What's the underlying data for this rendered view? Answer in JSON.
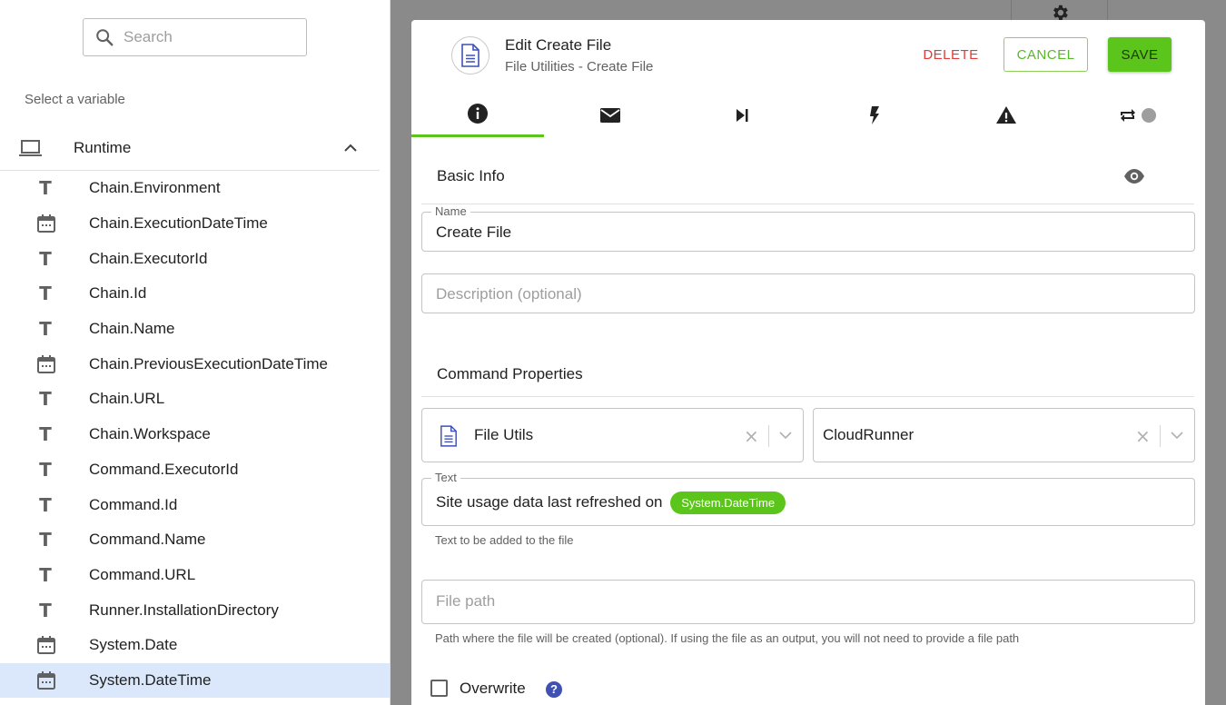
{
  "left_panel": {
    "search": {
      "placeholder": "Search",
      "value": ""
    },
    "select_label": "Select a variable",
    "group": {
      "title": "Runtime",
      "icon": "laptop-icon",
      "expanded": true
    },
    "variables": [
      {
        "name": "Chain.Environment",
        "type": "text"
      },
      {
        "name": "Chain.ExecutionDateTime",
        "type": "date"
      },
      {
        "name": "Chain.ExecutorId",
        "type": "text"
      },
      {
        "name": "Chain.Id",
        "type": "text"
      },
      {
        "name": "Chain.Name",
        "type": "text"
      },
      {
        "name": "Chain.PreviousExecutionDateTime",
        "type": "date"
      },
      {
        "name": "Chain.URL",
        "type": "text"
      },
      {
        "name": "Chain.Workspace",
        "type": "text"
      },
      {
        "name": "Command.ExecutorId",
        "type": "text"
      },
      {
        "name": "Command.Id",
        "type": "text"
      },
      {
        "name": "Command.Name",
        "type": "text"
      },
      {
        "name": "Command.URL",
        "type": "text"
      },
      {
        "name": "Runner.InstallationDirectory",
        "type": "text"
      },
      {
        "name": "System.Date",
        "type": "date"
      },
      {
        "name": "System.DateTime",
        "type": "date",
        "selected": true
      }
    ]
  },
  "dialog": {
    "title": "Edit Create File",
    "subtitle": "File Utilities - Create File",
    "buttons": {
      "delete": "DELETE",
      "cancel": "CANCEL",
      "save": "SAVE"
    },
    "tabs": [
      {
        "icon": "info-icon",
        "active": true
      },
      {
        "icon": "mail-icon",
        "active": false
      },
      {
        "icon": "skip-next-icon",
        "active": false
      },
      {
        "icon": "lightning-icon",
        "active": false
      },
      {
        "icon": "warning-icon",
        "active": false
      },
      {
        "icon": "repeat-toggle-icon",
        "active": false
      }
    ],
    "basic_info": {
      "title": "Basic Info",
      "name_label": "Name",
      "name_value": "Create File",
      "description_placeholder": "Description (optional)"
    },
    "command_properties": {
      "title": "Command Properties",
      "plugin_value": "File Utils",
      "runner_value": "CloudRunner",
      "text_label": "Text",
      "text_value": "Site usage data last refreshed on",
      "text_chip": "System.DateTime",
      "text_helper": "Text to be added to the file",
      "file_path_placeholder": "File path",
      "file_path_helper": "Path where the file will be created (optional). If using the file as an output, you will not need to provide a file path",
      "overwrite_label": "Overwrite",
      "overwrite_checked": false,
      "help_glyph": "?"
    }
  },
  "colors": {
    "accent_green": "#5cc51b",
    "delete_red": "#e53935",
    "selected_row": "#dbe8fb",
    "help_blue": "#3f51b5"
  }
}
